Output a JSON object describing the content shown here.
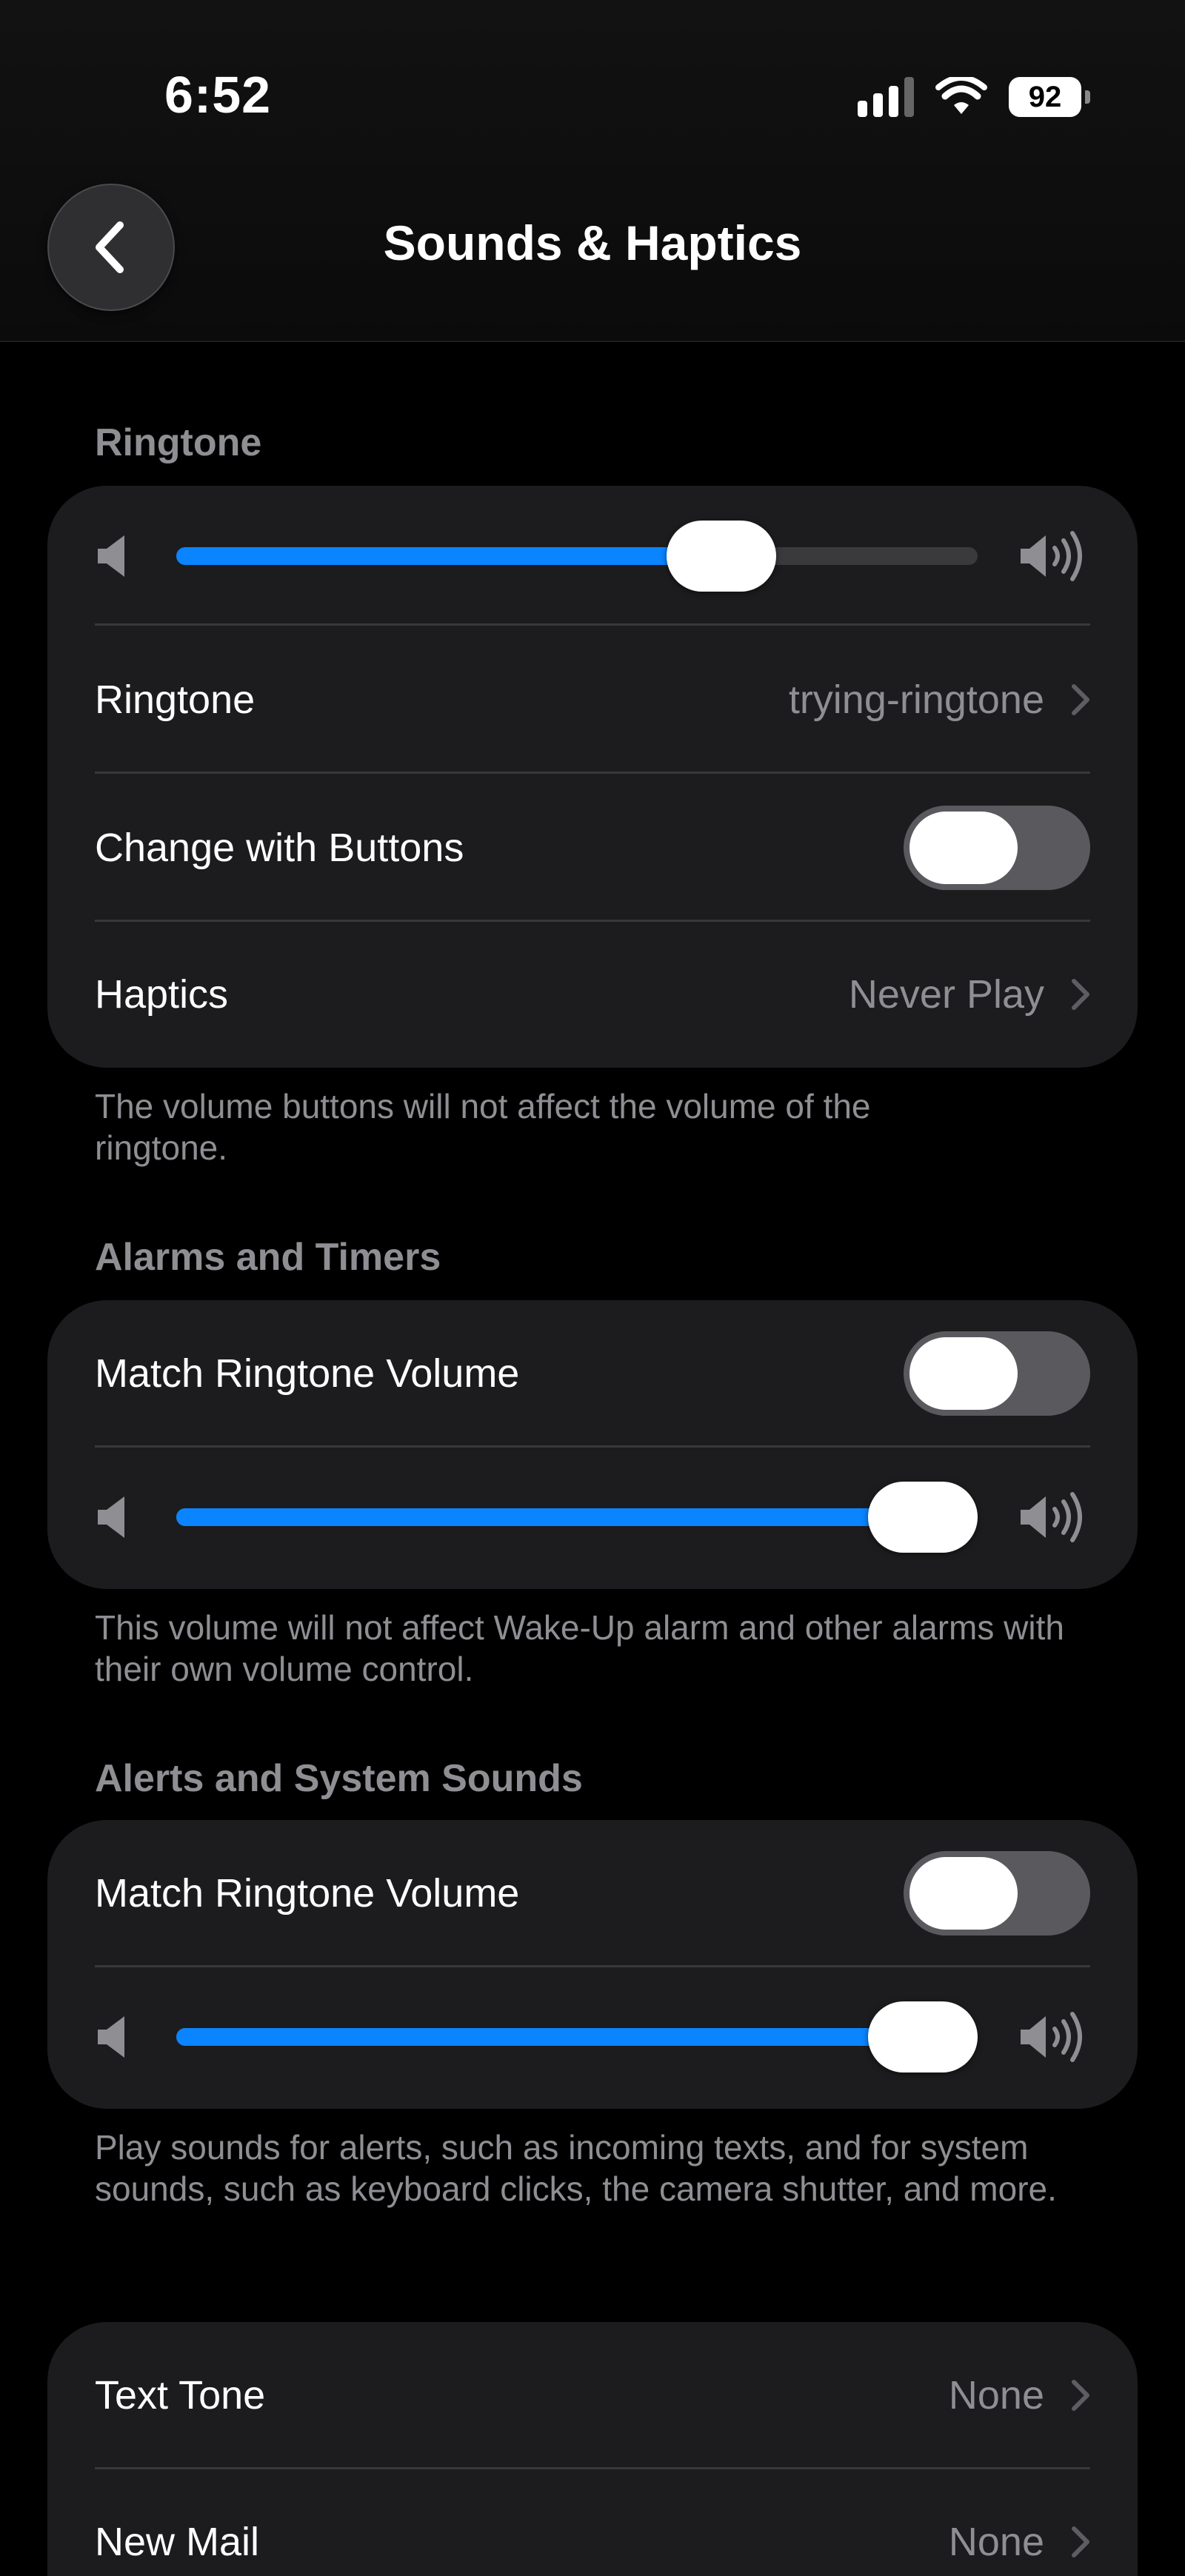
{
  "status_bar": {
    "time": "6:52",
    "battery": "92"
  },
  "nav": {
    "title": "Sounds & Haptics",
    "back_icon": "chevron-left-icon"
  },
  "ringtone_section": {
    "header": "Ringtone",
    "volume": 0.68,
    "ringtone_label": "Ringtone",
    "ringtone_value": "trying-ringtone",
    "change_with_buttons_label": "Change with Buttons",
    "change_with_buttons_on": false,
    "haptics_label": "Haptics",
    "haptics_value": "Never Play",
    "footer": "The volume buttons will not affect the volume of the ringtone."
  },
  "alarms_section": {
    "header": "Alarms and Timers",
    "match_label": "Match Ringtone Volume",
    "match_on": false,
    "volume": 1.0,
    "footer": "This volume will not affect Wake-Up alarm and other alarms with their own volume control."
  },
  "alerts_section": {
    "header": "Alerts and System Sounds",
    "match_label": "Match Ringtone Volume",
    "match_on": false,
    "volume": 1.0,
    "footer": "Play sounds for alerts, such as incoming texts, and for system sounds, such as keyboard clicks, the camera shutter, and more."
  },
  "tones_section": {
    "items": [
      {
        "label": "Text Tone",
        "value": "None"
      },
      {
        "label": "New Mail",
        "value": "None"
      }
    ]
  },
  "colors": {
    "accent": "#0a84ff",
    "background": "#000000",
    "card": "#1c1c1e",
    "secondary_text": "#8e8e93"
  }
}
